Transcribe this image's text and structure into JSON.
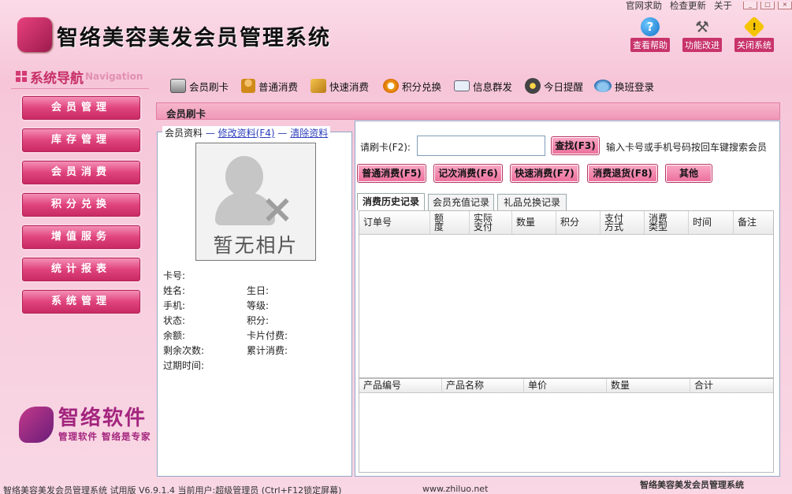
{
  "top_menu": {
    "help": "官网求助",
    "update": "检查更新",
    "about": "关于"
  },
  "app_title": "智络美容美发会员管理系统",
  "top_buttons": [
    {
      "label": "查看帮助",
      "icon": "help-icon"
    },
    {
      "label": "功能改进",
      "icon": "tools-icon"
    },
    {
      "label": "关闭系统",
      "icon": "warning-icon"
    }
  ],
  "nav": {
    "title": "系统导航",
    "title_en": "Navigation",
    "items": [
      "会员管理",
      "库存管理",
      "会员消费",
      "积分兑换",
      "增值服务",
      "统计报表",
      "系统管理"
    ]
  },
  "brand": {
    "name": "智络软件",
    "slogan": "管理软件 智络是专家"
  },
  "toolbar": [
    {
      "label": "会员刷卡",
      "icon": "card-icon"
    },
    {
      "label": "普通消费",
      "icon": "person-icon"
    },
    {
      "label": "快速消费",
      "icon": "fast-icon"
    },
    {
      "label": "积分兑换",
      "icon": "exchange-icon"
    },
    {
      "label": "信息群发",
      "icon": "mail-icon"
    },
    {
      "label": "今日提醒",
      "icon": "clock-icon"
    },
    {
      "label": "换班登录",
      "icon": "shift-icon"
    }
  ],
  "panel_title": "会员刷卡",
  "member": {
    "legend": "会员资料",
    "edit_link": "修改资料(F4)",
    "clear_link": "清除资料",
    "photo_text": "暂无相片",
    "fields_left": [
      "卡号:",
      "姓名:",
      "手机:",
      "状态:",
      "余额:",
      "剩余次数:",
      "过期时间:"
    ],
    "fields_right": [
      "生日:",
      "等级:",
      "积分:",
      "卡片付费:",
      "累计消费:"
    ]
  },
  "swipe": {
    "label": "请刷卡(F2):",
    "value": "",
    "search_button": "查找(F3)",
    "hint": "输入卡号或手机号码按回车键搜索会员"
  },
  "actions": [
    "普通消费(F5)",
    "记次消费(F6)",
    "快速消费(F7)",
    "消费退货(F8)",
    "其他"
  ],
  "tabs": [
    "消费历史记录",
    "会员充值记录",
    "礼品兑换记录"
  ],
  "history_columns": [
    "订单号",
    "额度",
    "实际支付",
    "数量",
    "积分",
    "支付方式",
    "消费类型",
    "时间",
    "备注"
  ],
  "detail_columns": [
    "产品编号",
    "产品名称",
    "单价",
    "数量",
    "合计"
  ],
  "status_bar": {
    "left": "智络美容美发会员管理系统 试用版 V6.9.1.4 当前用户:超级管理员 (Ctrl+F12锁定屏幕)",
    "url": "www.zhiluo.net",
    "right": "智络美容美发会员管理系统"
  }
}
